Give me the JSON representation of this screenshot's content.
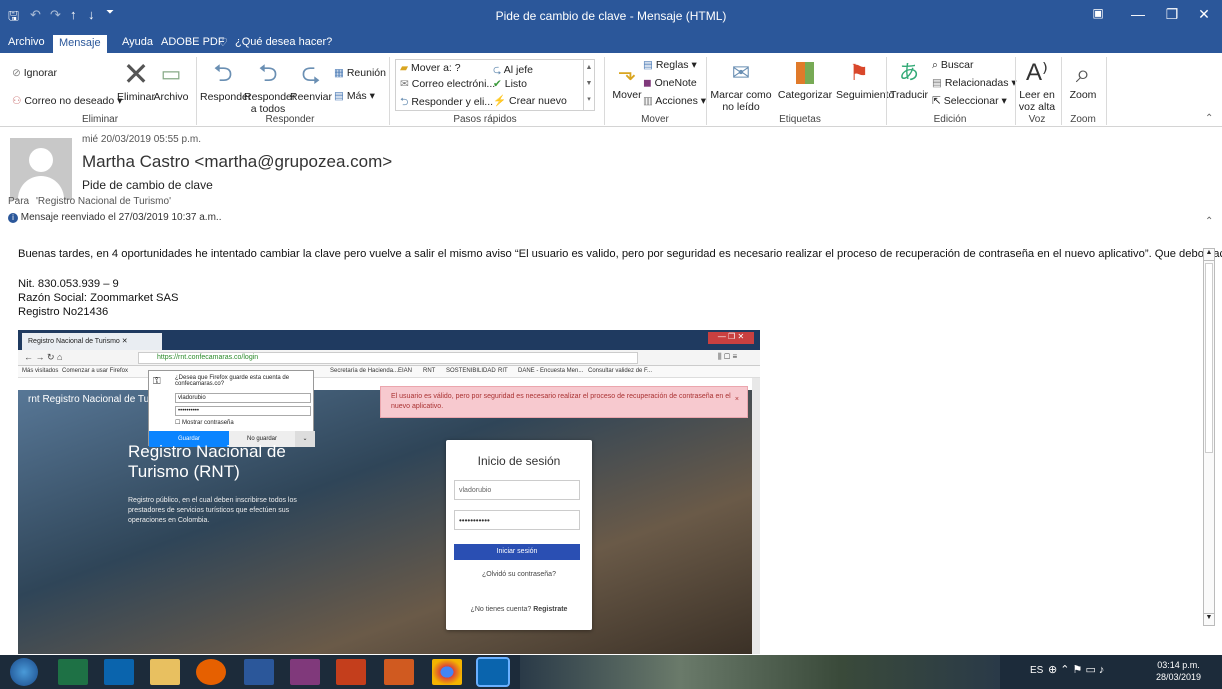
{
  "window": {
    "title": "Pide de cambio de clave  -  Mensaje (HTML)"
  },
  "tabs": [
    {
      "label": "Archivo"
    },
    {
      "label": "Mensaje"
    },
    {
      "label": "Ayuda"
    },
    {
      "label": "ADOBE PDF"
    },
    {
      "label": "¿Qué desea hacer?"
    }
  ],
  "ribbon": {
    "eliminar": {
      "ignorar": "Ignorar",
      "correo_no_deseado": "Correo no deseado",
      "eliminar": "Eliminar",
      "archivo": "Archivo",
      "group": "Eliminar"
    },
    "responder": {
      "responder": "Responder",
      "responder_todos": "Responder a todos",
      "reenviar": "Reenviar",
      "reunion": "Reunión",
      "mas": "Más",
      "group": "Responder"
    },
    "pasos": {
      "mover_a": "Mover a: ?",
      "correo_e": "Correo electróni...",
      "responder_eli": "Responder y eli...",
      "al_jefe": "Al jefe",
      "listo": "Listo",
      "crear_nuevo": "Crear nuevo",
      "group": "Pasos rápidos"
    },
    "mover": {
      "mover": "Mover",
      "reglas": "Reglas",
      "onenote": "OneNote",
      "acciones": "Acciones",
      "group": "Mover"
    },
    "etiquetas": {
      "marcar": "Marcar como no leído",
      "categorizar": "Categorizar",
      "seguimiento": "Seguimiento",
      "group": "Etiquetas"
    },
    "edicion": {
      "traducir": "Traducir",
      "buscar": "Buscar",
      "relacionadas": "Relacionadas",
      "seleccionar": "Seleccionar",
      "group": "Edición"
    },
    "voz": {
      "leer": "Leer en voz alta",
      "group": "Voz"
    },
    "zoom": {
      "zoom": "Zoom",
      "group": "Zoom"
    }
  },
  "message": {
    "date": "mié 20/03/2019 05:55 p.m.",
    "sender": "Martha Castro <martha@grupozea.com>",
    "subject": "Pide de cambio de clave",
    "to_label": "Para",
    "to": "'Registro Nacional de Turismo'",
    "forward_note": "Mensaje reenviado el 27/03/2019 10:37 a.m..",
    "body": [
      "Buenas tardes,  en 4 oportunidades he intentado cambiar la clave pero vuelve a salir el mismo aviso  “El usuario es valido, pero por seguridad es necesario realizar el proceso de recuperación de contraseña en el nuevo aplicativo”.  Que debo hacer?.",
      "Nit. 830.053.939 – 9",
      "Razón Social:  Zoommarket SAS",
      "Registro No21436"
    ]
  },
  "embedded": {
    "tab_title": "Registro Nacional de Turismo",
    "url": "https://rnt.confecamaras.co/login",
    "bookmarks": [
      "Más visitados",
      "Comenzar a usar Firefox",
      "Secretaría de Hacienda...",
      "EIAN",
      "RNT",
      "SOSTENIBILIDAD",
      "RIT",
      "DANE - Encuesta Men...",
      "Consultar validez de F..."
    ],
    "save_prompt": {
      "question": "¿Desea que Firefox guarde esta cuenta de confecamaras.co?",
      "user": "vladorubio",
      "password": "••••••••••",
      "show_pwd": "Mostrar contraseña",
      "save": "Guardar",
      "dont_save": "No guardar"
    },
    "site_brand": "rnt Registro Nacional de Tu",
    "alert": "El usuario es válido, pero por seguridad es necesario realizar el proceso de recuperación de contraseña en el nuevo aplicativo.",
    "hero_title": "Registro Nacional de Turismo (RNT)",
    "hero_text": "Registro público, en el cual deben inscribirse todos los prestadores de servicios turísticos que efectúen sus operaciones en Colombia.",
    "login": {
      "title": "Inicio de sesión",
      "user": "vladorubio",
      "password": "•••••••••••",
      "button": "Iniciar sesión",
      "forgot": "¿Olvidó su contraseña?",
      "no_account": "¿No tienes cuenta?",
      "register": "Registrate"
    }
  },
  "taskbar": {
    "lang": "ES",
    "time": "03:14 p.m.",
    "date": "28/03/2019"
  }
}
